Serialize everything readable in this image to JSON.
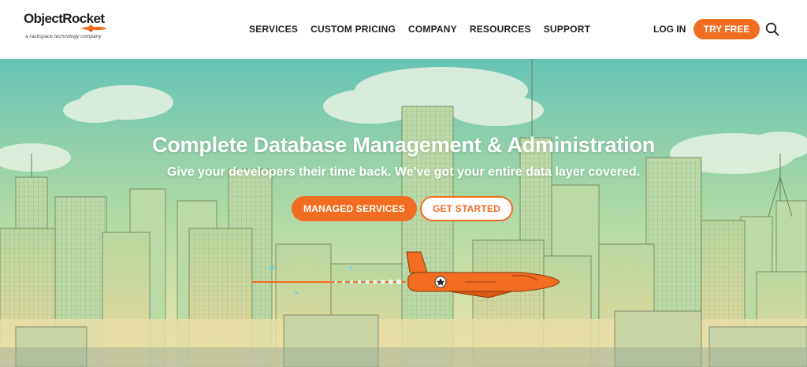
{
  "header": {
    "logo": {
      "wordmark": "ObjectRocket",
      "tagline": "a rackspace technology company"
    },
    "nav": [
      {
        "label": "SERVICES"
      },
      {
        "label": "CUSTOM PRICING"
      },
      {
        "label": "COMPANY"
      },
      {
        "label": "RESOURCES"
      },
      {
        "label": "SUPPORT"
      }
    ],
    "login_label": "LOG IN",
    "try_free_label": "TRY FREE",
    "search_icon": "search-icon"
  },
  "hero": {
    "title": "Complete Database Management & Administration",
    "subtitle": "Give your developers their time back. We've got your entire data layer covered.",
    "primary_button": "MANAGED SERVICES",
    "secondary_button": "GET STARTED",
    "illustration": "city-skyline-with-rocket-plane"
  },
  "colors": {
    "accent": "#f26d21",
    "sky_top": "#6cc7b8",
    "sky_bottom": "#f4e9a8",
    "text_dark": "#222222"
  }
}
